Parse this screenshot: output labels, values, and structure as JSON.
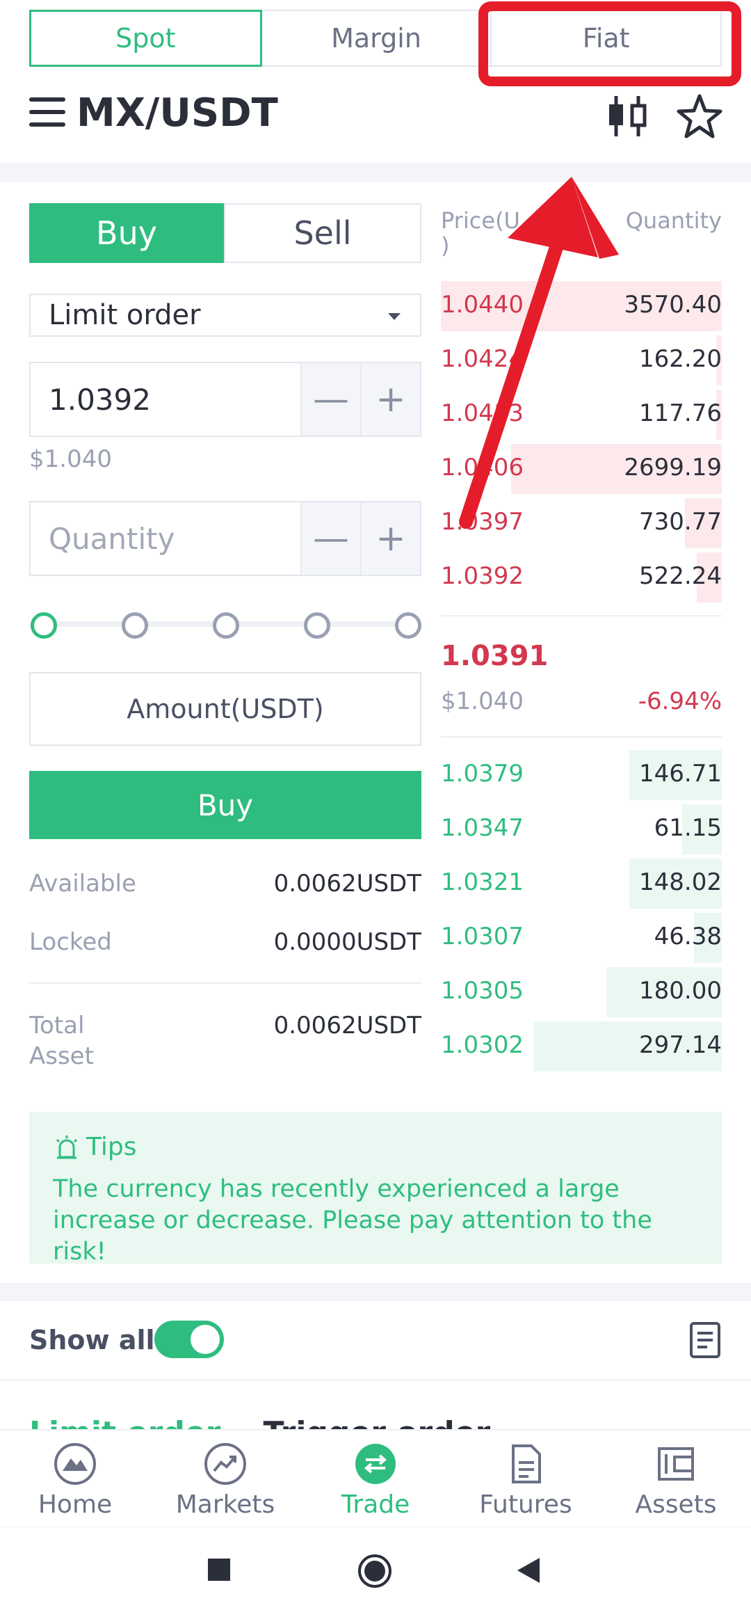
{
  "top_tabs": {
    "spot": "Spot",
    "margin": "Margin",
    "fiat": "Fiat"
  },
  "header": {
    "pair": "MX/USDT"
  },
  "trade_form": {
    "buy_tab": "Buy",
    "sell_tab": "Sell",
    "order_type": "Limit order",
    "price_value": "1.0392",
    "price_usd": "$1.040",
    "quantity_placeholder": "Quantity",
    "minus": "—",
    "plus": "+",
    "amount_label": "Amount(USDT)",
    "buy_button": "Buy",
    "available_label": "Available",
    "available_value": "0.0062USDT",
    "locked_label": "Locked",
    "locked_value": "0.0000USDT",
    "total_asset_label_1": "Total",
    "total_asset_label_2": "Asset",
    "total_asset_value": "0.0062USDT"
  },
  "order_book": {
    "price_header_1": "Price(U",
    "price_header_2": ")",
    "quantity_header": "Quantity",
    "asks": [
      {
        "price": "1.0440",
        "qty": "3570.40",
        "depth": 1.0
      },
      {
        "price": "1.0424",
        "qty": "162.20",
        "depth": 0.02
      },
      {
        "price": "1.0413",
        "qty": "117.76",
        "depth": 0.02
      },
      {
        "price": "1.0406",
        "qty": "2699.19",
        "depth": 0.75
      },
      {
        "price": "1.0397",
        "qty": "730.77",
        "depth": 0.13
      },
      {
        "price": "1.0392",
        "qty": "522.24",
        "depth": 0.09
      }
    ],
    "last_price": "1.0391",
    "last_usd": "$1.040",
    "change": "-6.94%",
    "bids": [
      {
        "price": "1.0379",
        "qty": "146.71",
        "depth": 0.33
      },
      {
        "price": "1.0347",
        "qty": "61.15",
        "depth": 0.14
      },
      {
        "price": "1.0321",
        "qty": "148.02",
        "depth": 0.33
      },
      {
        "price": "1.0307",
        "qty": "46.38",
        "depth": 0.1
      },
      {
        "price": "1.0305",
        "qty": "180.00",
        "depth": 0.41
      },
      {
        "price": "1.0302",
        "qty": "297.14",
        "depth": 0.67
      }
    ]
  },
  "tips": {
    "title": "Tips",
    "text": "The currency has recently experienced a large increase or decrease. Please pay attention to the risk!"
  },
  "orders": {
    "show_all": "Show all",
    "tab_limit": "Limit order",
    "tab_trigger": "Trigger order"
  },
  "bottom_nav": {
    "home": "Home",
    "markets": "Markets",
    "trade": "Trade",
    "futures": "Futures",
    "assets": "Assets"
  },
  "colors": {
    "accent": "#2fbd7f",
    "sell": "#d2384f",
    "annotation": "#e51d2a"
  }
}
